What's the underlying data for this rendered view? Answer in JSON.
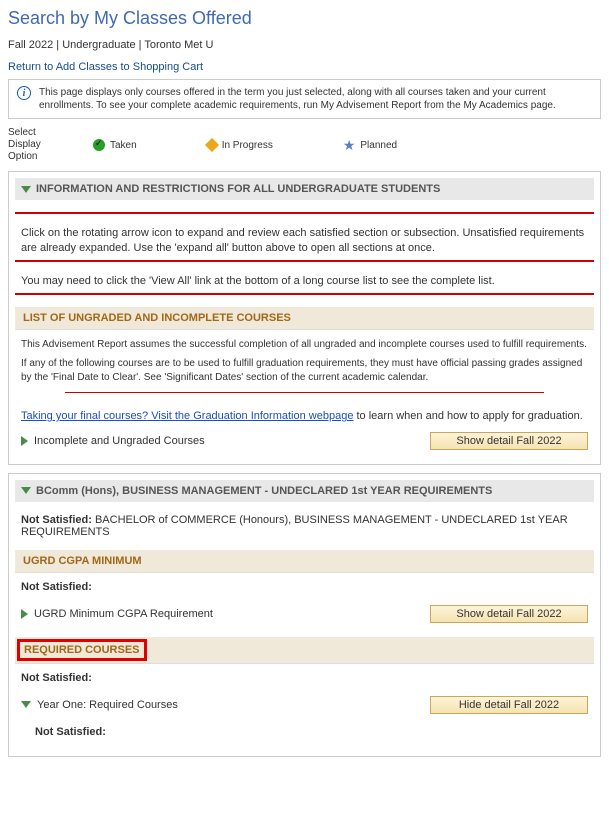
{
  "page": {
    "title": "Search by My Classes Offered",
    "breadcrumb": "Fall 2022 | Undergraduate | Toronto Met U",
    "return_link": "Return to Add Classes to Shopping Cart",
    "info_text": "This page displays only courses offered in the term you just selected, along with all courses taken and your current enrollments.  To see your complete academic requirements, run My Advisement Report from the My Academics page."
  },
  "legend": {
    "label": "Select Display Option",
    "taken": "Taken",
    "in_progress": "In Progress",
    "planned": "Planned"
  },
  "section1": {
    "header": "INFORMATION AND RESTRICTIONS FOR ALL UNDERGRADUATE STUDENTS",
    "para1": "Click on the rotating arrow icon to expand and review each satisfied section or subsection. Unsatisfied requirements are already expanded. Use the 'expand all' button above to open all sections at once.",
    "para2": "You may need to click the 'View All' link at the bottom of a long course list to see the complete list.",
    "sub_header": "LIST OF UNGRADED AND INCOMPLETE COURSES",
    "sub_text1": "This Advisement Report assumes the successful completion of all ungraded and incomplete courses used to fulfill requirements.",
    "sub_text2": "If any of the following courses are to be used to fulfill graduation requirements, they must have official passing grades assigned by the 'Final Date to Clear'. See 'Significant Dates' section of the current academic calendar.",
    "grad_link": "Taking your final courses? Visit the Graduation Information webpage",
    "grad_tail": " to learn when and how to apply for graduation.",
    "req_label": "Incomplete and Ungraded Courses",
    "detail_btn": "Show detail Fall 2022"
  },
  "section2": {
    "header": "BComm (Hons), BUSINESS MANAGEMENT - UNDECLARED 1st YEAR REQUIREMENTS",
    "not_sat_label": "Not Satisfied:",
    "not_sat_text": "  BACHELOR of COMMERCE (Honours), BUSINESS MANAGEMENT - UNDECLARED 1st YEAR REQUIREMENTS",
    "sub1_header": "UGRD CGPA MINIMUM",
    "sub1_not_sat": "Not Satisfied:",
    "sub1_req": "UGRD Minimum CGPA Requirement",
    "sub1_btn": "Show detail Fall 2022",
    "sub2_header": "REQUIRED COURSES",
    "sub2_not_sat": "Not Satisfied:",
    "sub2_req": "Year One: Required Courses",
    "sub2_btn": "Hide detail Fall 2022",
    "sub2_child_not_sat": "Not Satisfied:"
  }
}
